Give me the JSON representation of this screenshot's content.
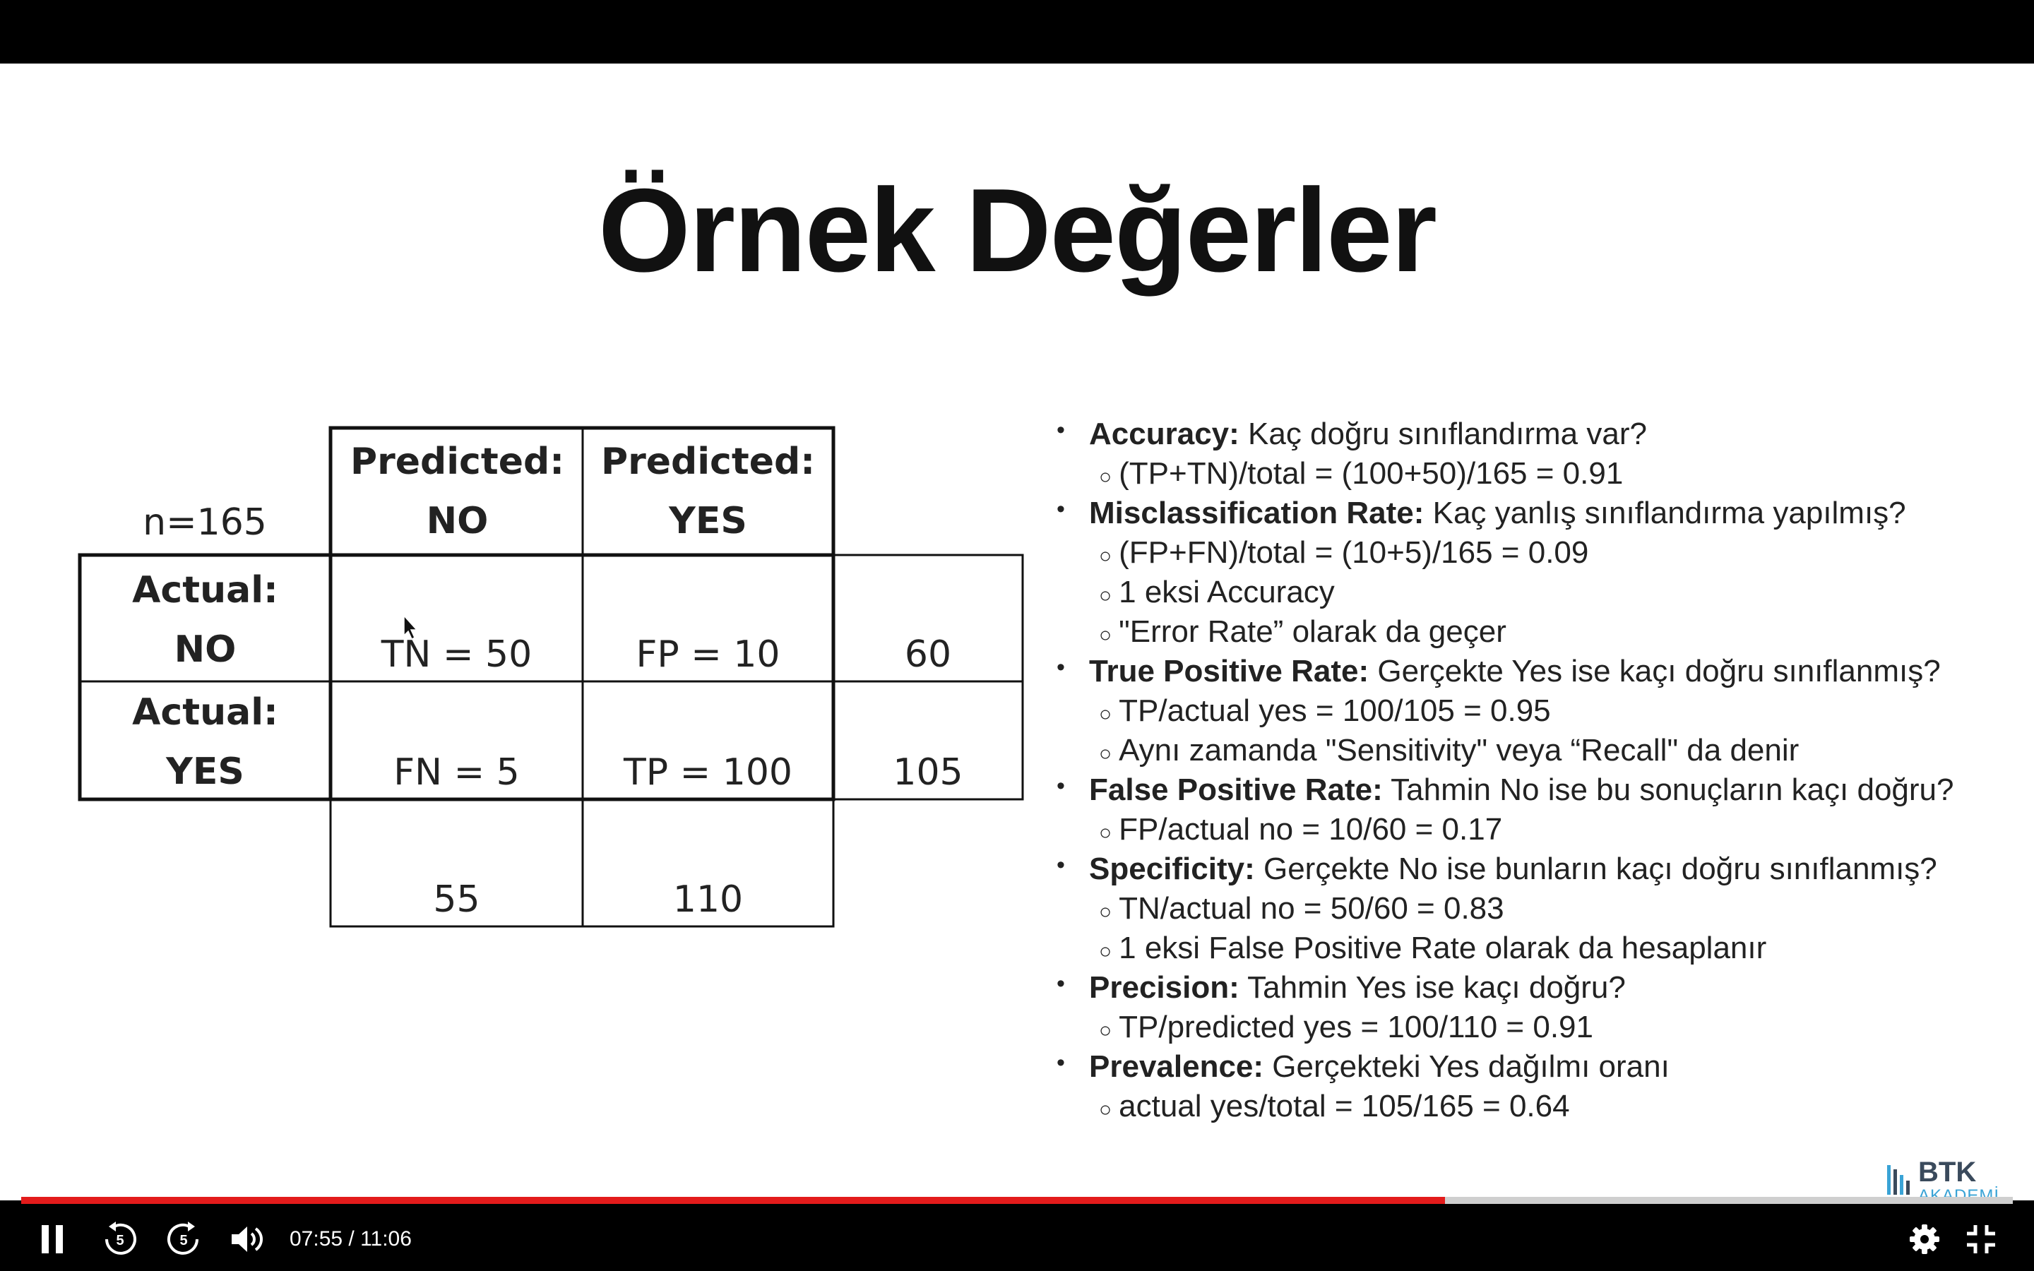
{
  "slide": {
    "title": "Örnek Değerler",
    "n_label": "n=165",
    "matrix": {
      "pred_no_line1": "Predicted:",
      "pred_no_line2": "NO",
      "pred_yes_line1": "Predicted:",
      "pred_yes_line2": "YES",
      "actual_no_line1": "Actual:",
      "actual_no_line2": "NO",
      "actual_yes_line1": "Actual:",
      "actual_yes_line2": "YES",
      "tn": "TN = 50",
      "fp": "FP = 10",
      "fn": "FN = 5",
      "tp": "TP = 100",
      "row_total_no": "60",
      "row_total_yes": "105",
      "col_total_no": "55",
      "col_total_yes": "110"
    },
    "bullets": [
      {
        "bold": "Accuracy:",
        "text": " Kaç doğru sınıflandırma var?"
      },
      {
        "sub": "(TP+TN)/total = (100+50)/165 = 0.91"
      },
      {
        "bold": "Misclassification Rate:",
        "text": " Kaç yanlış sınıflandırma yapılmış?"
      },
      {
        "sub": "(FP+FN)/total = (10+5)/165 = 0.09"
      },
      {
        "sub": "1 eksi Accuracy"
      },
      {
        "sub": "\"Error Rate” olarak da geçer"
      },
      {
        "bold": "True Positive Rate:",
        "text": " Gerçekte Yes ise kaçı doğru sınıflanmış?"
      },
      {
        "sub": "TP/actual yes = 100/105 = 0.95"
      },
      {
        "sub": "Aynı zamanda  \"Sensitivity\" veya “Recall\" da denir"
      },
      {
        "bold": "False Positive Rate:",
        "text": " Tahmin No ise bu sonuçların kaçı doğru?"
      },
      {
        "sub": "FP/actual no = 10/60 = 0.17"
      },
      {
        "bold": "Specificity:",
        "text": " Gerçekte No ise bunların kaçı doğru sınıflanmış?"
      },
      {
        "sub": "TN/actual no = 50/60 = 0.83"
      },
      {
        "sub": "1 eksi False Positive Rate olarak da hesaplanır"
      },
      {
        "bold": "Precision:",
        "text": " Tahmin Yes ise kaçı doğru?"
      },
      {
        "sub": "TP/predicted yes = 100/110 = 0.91"
      },
      {
        "bold": "Prevalence:",
        "text": " Gerçekteki Yes dağılmı oranı"
      },
      {
        "sub": "actual yes/total = 105/165 = 0.64"
      }
    ],
    "logo": {
      "line1": "BTK",
      "line2": "AKADEMİ"
    }
  },
  "player": {
    "time_display": "07:55 / 11:06",
    "progress_fraction": 0.715,
    "rewind_seconds": "5",
    "forward_seconds": "5",
    "accent_color": "#e31b1b",
    "icons": [
      "pause-icon",
      "rewind-5-icon",
      "forward-5-icon",
      "volume-icon",
      "settings-icon",
      "exit-fullscreen-icon"
    ]
  }
}
